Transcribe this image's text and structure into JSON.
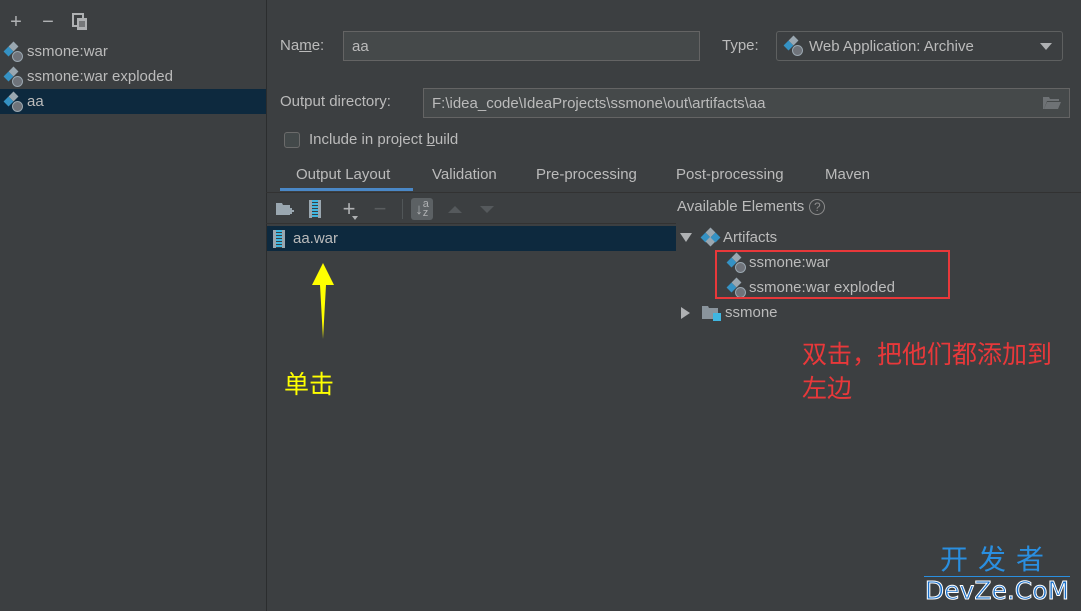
{
  "sidebar": {
    "toolbar": {
      "add": "+",
      "remove": "−"
    },
    "items": [
      {
        "label": "ssmone:war",
        "selected": false
      },
      {
        "label": "ssmone:war exploded",
        "selected": false
      },
      {
        "label": "aa",
        "selected": true
      }
    ]
  },
  "form": {
    "name_label_pre": "Na",
    "name_label_mnemonic": "m",
    "name_label_post": "e:",
    "name_value": "aa",
    "type_label": "Type:",
    "type_value": "Web Application: Archive",
    "output_dir_label": "Output directory:",
    "output_dir_value": "F:\\idea_code\\IdeaProjects\\ssmone\\out\\artifacts\\aa",
    "include_pre": "Include in project ",
    "include_mnemonic": "b",
    "include_post": "uild",
    "include_checked": false
  },
  "tabs": [
    {
      "label": "Output Layout",
      "active": true
    },
    {
      "label": "Validation",
      "active": false
    },
    {
      "label": "Pre-processing",
      "active": false
    },
    {
      "label": "Post-processing",
      "active": false
    },
    {
      "label": "Maven",
      "active": false
    }
  ],
  "layout": {
    "root_item": "aa.war",
    "sort_a": "a",
    "sort_z": "z"
  },
  "available": {
    "title": "Available Elements",
    "help": "?",
    "artifacts_label": "Artifacts",
    "artifact_items": [
      "ssmone:war",
      "ssmone:war exploded"
    ],
    "module_label": "ssmone"
  },
  "annotations": {
    "single_click": "单击",
    "double_click_line1": "双击，把他们都添加到",
    "double_click_line2": "左边"
  },
  "watermark": {
    "top": "开发者",
    "bottom": "DevZe.CoM"
  },
  "colors": {
    "background": "#3c3f41",
    "selection": "#0d293e",
    "accent_blue": "#4a88c7",
    "annotation_red": "#e8383a",
    "annotation_yellow": "#ffff00"
  }
}
